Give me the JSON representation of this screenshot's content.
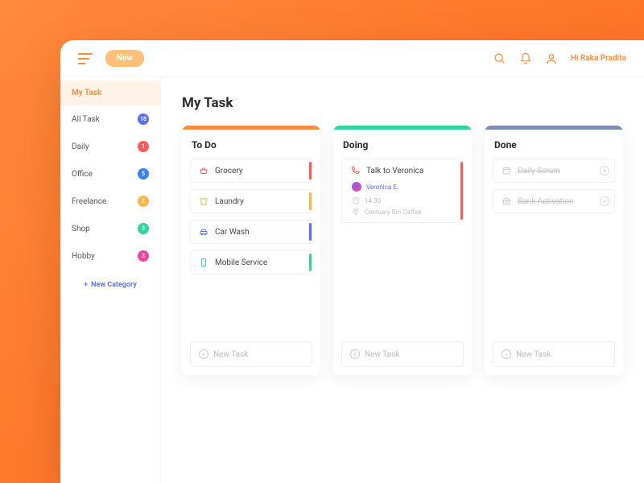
{
  "topbar": {
    "new_label": "New",
    "greeting": "Hi Raka Pradita"
  },
  "sidebar": {
    "items": [
      {
        "label": "My Task",
        "badge": null,
        "color": null,
        "active": true
      },
      {
        "label": "All Task",
        "badge": "18",
        "color": "#5b6cff"
      },
      {
        "label": "Daily",
        "badge": "1",
        "color": "#ff5a5a"
      },
      {
        "label": "Office",
        "badge": "5",
        "color": "#3b82f6"
      },
      {
        "label": "Freelance",
        "badge": "2",
        "color": "#ffb547"
      },
      {
        "label": "Shop",
        "badge": "3",
        "color": "#34d399"
      },
      {
        "label": "Hobby",
        "badge": "3",
        "color": "#ec4899"
      }
    ],
    "new_category": "New Category"
  },
  "page": {
    "title": "My Task"
  },
  "columns": {
    "todo": {
      "title": "To Do",
      "bar": "#ff8a3d",
      "cards": [
        {
          "label": "Grocery",
          "icon": "basket",
          "iconColor": "#ff5a5a",
          "accent": "#ff5a5a"
        },
        {
          "label": "Laundry",
          "icon": "shirt",
          "iconColor": "#ffb547",
          "accent": "#ffb547"
        },
        {
          "label": "Car Wash",
          "icon": "car",
          "iconColor": "#5b6cff",
          "accent": "#5b6cff"
        },
        {
          "label": "Mobile Service",
          "icon": "phone",
          "iconColor": "#34d399",
          "accent": "#34d399"
        }
      ]
    },
    "doing": {
      "title": "Doing",
      "bar": "#34d399",
      "card": {
        "label": "Talk to Veronica",
        "icon": "phone-call",
        "iconColor": "#ff5a5a",
        "accent": "#ff5a5a",
        "person": "Veronica E.",
        "time": "14.30",
        "location": "Centuary Bin Caffee"
      }
    },
    "done": {
      "title": "Done",
      "bar": "#7b8db5",
      "cards": [
        {
          "label": "Daily Scrum",
          "icon": "calendar"
        },
        {
          "label": "Bank Activation",
          "icon": "bank"
        }
      ]
    },
    "new_task": "New Task"
  }
}
